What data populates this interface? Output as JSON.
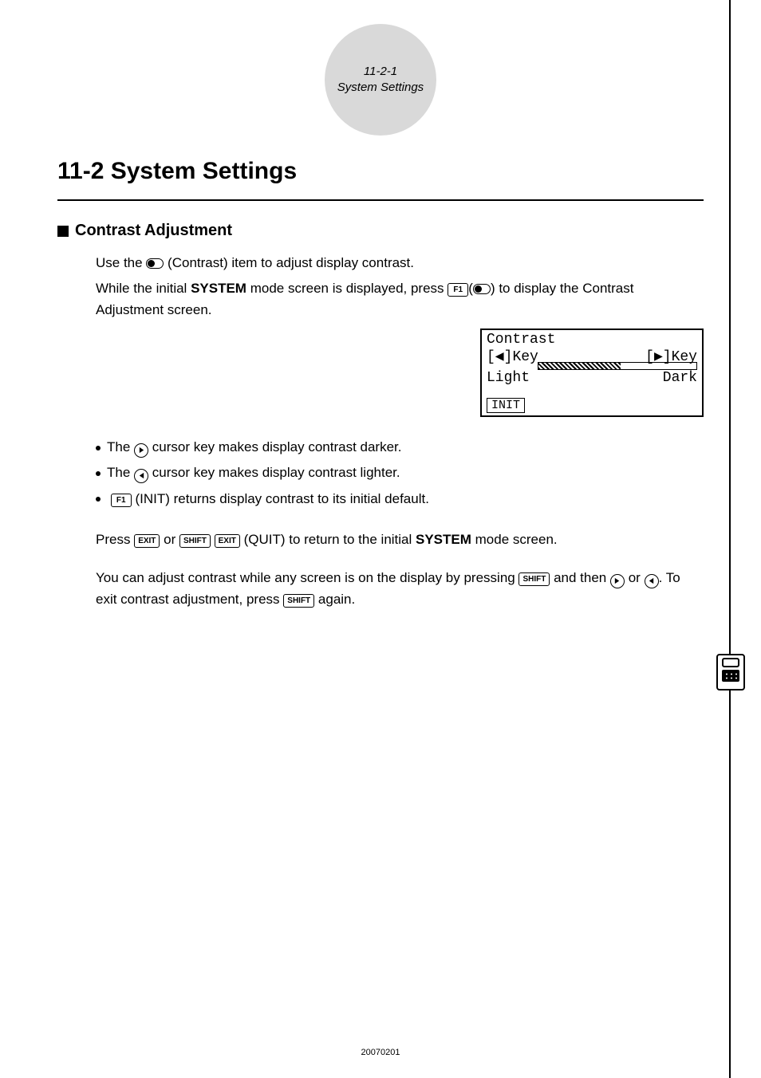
{
  "header": {
    "line1": "11-2-1",
    "line2": "System Settings"
  },
  "title": "11-2  System Settings",
  "section": {
    "heading": "Contrast Adjustment"
  },
  "para1a": "Use the ",
  "para1b": " (Contrast) item to adjust display contrast.",
  "para2a": "While the initial ",
  "para2b": "SYSTEM",
  "para2c": " mode screen is displayed, press ",
  "para2d": " to display the Contrast Adjustment screen.",
  "f1_label": "F1",
  "lcd": {
    "title": "Contrast",
    "left_key": "[◀]Key",
    "right_key": "[▶]Key",
    "light": "Light",
    "dark": "Dark",
    "init": "INIT"
  },
  "bullets": {
    "b1a": "The ",
    "b1b": " cursor key makes display contrast darker.",
    "b2a": "The ",
    "b2b": " cursor key makes display contrast lighter.",
    "b3a": "(INIT) returns display contrast to its initial default."
  },
  "exit_label": "EXIT",
  "shift_label": "SHIFT",
  "para3a": "Press ",
  "para3b": " or ",
  "para3c": "(QUIT) to return to the initial ",
  "para3d": "SYSTEM",
  "para3e": " mode screen.",
  "para4a": "You can adjust contrast while any screen is on the display by pressing ",
  "para4b": " and then ",
  "para4c": " or ",
  "para4d": ". To exit contrast adjustment, press ",
  "para4e": " again.",
  "footer": "20070201"
}
